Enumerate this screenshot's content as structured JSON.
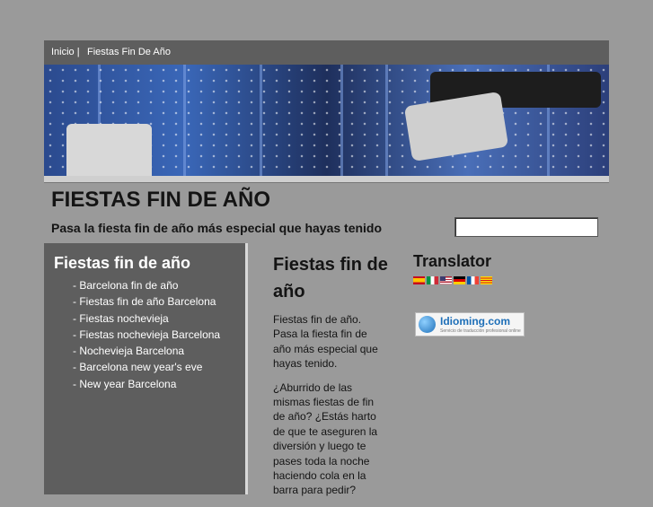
{
  "nav": {
    "items": [
      "Inicio |",
      "Fiestas Fin De Año"
    ]
  },
  "header": {
    "title": "FIESTAS FIN DE AÑO",
    "subtitle": "Pasa la fiesta fin de año más especial que hayas tenido"
  },
  "search": {
    "value": ""
  },
  "sidebar": {
    "title": "Fiestas fin de año",
    "items": [
      "- Barcelona fin de año",
      "- Fiestas fin de año Barcelona",
      "- Fiestas nochevieja",
      "- Fiestas nochevieja Barcelona",
      "- Nochevieja Barcelona",
      "- Barcelona new year's eve",
      "- New year Barcelona"
    ]
  },
  "main": {
    "title": "Fiestas fin de año",
    "paragraphs": [
      "Fiestas fin de año. Pasa la fiesta fin de año más especial que hayas tenido.",
      "¿Aburrido de las mismas fiestas de fin de año? ¿Estás harto de que te aseguren la diversión y luego te pases toda la noche haciendo cola en la barra para pedir?"
    ]
  },
  "translator": {
    "title": "Translator",
    "flags": [
      "spanish-flag-icon",
      "italian-flag-icon",
      "english-flag-icon",
      "german-flag-icon",
      "french-flag-icon",
      "catalan-flag-icon"
    ],
    "badge_brand": "Idioming.com",
    "badge_tagline": "Servicio de traducción profesional online"
  },
  "colors": {
    "background": "#9a9a9a",
    "nav_bar": "#5e5e5e",
    "sidebar": "#5e5e5e",
    "text_dark": "#141414",
    "text_light": "#ffffff"
  }
}
